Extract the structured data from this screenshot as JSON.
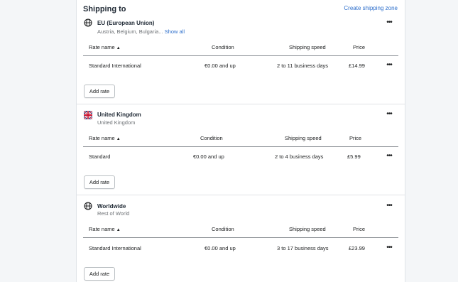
{
  "card": {
    "title": "Shipping to",
    "create_link": "Create shipping zone"
  },
  "zones": [
    {
      "icon": "globe-icon",
      "name": "EU (European Union)",
      "countries": "Austria, Belgium, Bulgaria...",
      "show_all": "Show all",
      "headers": {
        "rate_name": "Rate name",
        "condition": "Condition",
        "speed": "Shipping speed",
        "price": "Price"
      },
      "rates": [
        {
          "name": "Standard International",
          "condition": "€0.00 and up",
          "speed": "2 to 11 business days",
          "price": "£14.99"
        }
      ],
      "add_rate": "Add rate"
    },
    {
      "icon": "uk-flag-icon",
      "name": "United Kingdom",
      "countries": "United Kingdom",
      "headers": {
        "rate_name": "Rate name",
        "condition": "Condition",
        "speed": "Shipping speed",
        "price": "Price"
      },
      "rates": [
        {
          "name": "Standard",
          "condition": "€0.00 and up",
          "speed": "2 to 4 business days",
          "price": "£5.99"
        }
      ],
      "add_rate": "Add rate"
    },
    {
      "icon": "globe-icon",
      "name": "Worldwide",
      "countries": "Rest of World",
      "headers": {
        "rate_name": "Rate name",
        "condition": "Condition",
        "speed": "Shipping speed",
        "price": "Price"
      },
      "rates": [
        {
          "name": "Standard International",
          "condition": "€0.00 and up",
          "speed": "3 to 17 business days",
          "price": "£23.99"
        }
      ],
      "add_rate": "Add rate"
    }
  ],
  "menu_glyph": "•••",
  "sort_glyph": "▲"
}
